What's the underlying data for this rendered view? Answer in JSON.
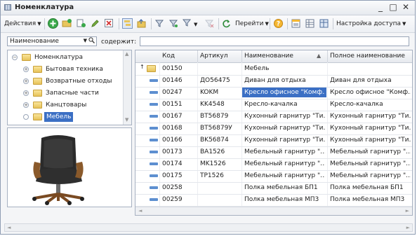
{
  "window": {
    "title": "Номенклатура",
    "controls": [
      "_",
      "□",
      "✕"
    ]
  },
  "toolbar": {
    "actions_label": "Действия",
    "goto_label": "Перейти",
    "access_label": "Настройка доступа"
  },
  "filter": {
    "field_value": "Наименование",
    "contains_label": "содержит:",
    "search_value": ""
  },
  "tree": {
    "items": [
      {
        "label": "Номенклатура",
        "level": 0,
        "expander": "−",
        "selected": false
      },
      {
        "label": "Бытовая техника",
        "level": 1,
        "expander": "+",
        "selected": false
      },
      {
        "label": "Возвратные отходы",
        "level": 1,
        "expander": "+",
        "selected": false
      },
      {
        "label": "Запасные части",
        "level": 1,
        "expander": "+",
        "selected": false
      },
      {
        "label": "Канцтовары",
        "level": 1,
        "expander": "+",
        "selected": false
      },
      {
        "label": "Мебель",
        "level": 1,
        "expander": "",
        "selected": true
      }
    ]
  },
  "grid": {
    "columns": [
      "Код",
      "Артикул",
      "Наименование",
      "Полное наименование"
    ],
    "sorted_column_indicator": "▲",
    "parent_row": {
      "code": "00150",
      "name": "Мебель"
    },
    "rows": [
      {
        "code": "00146",
        "article": "ДО56475",
        "name": "Диван для отдыха",
        "full": "Диван для отдыха",
        "selected": false
      },
      {
        "code": "00247",
        "article": "KOKM",
        "name": "Кресло офисное \"Комф...",
        "full": "Кресло офисное \"Комф...",
        "selected": true
      },
      {
        "code": "00151",
        "article": "KK4548",
        "name": "Кресло-качалка",
        "full": "Кресло-качалка",
        "selected": false
      },
      {
        "code": "00167",
        "article": "BT56879",
        "name": "Кухонный гарнитур \"Ти...",
        "full": "Кухонный гарнитур \"Ти...",
        "selected": false
      },
      {
        "code": "00168",
        "article": "BT56879У",
        "name": "Кухонный гарнитур \"Ти...",
        "full": "Кухонный гарнитур \"Ти...",
        "selected": false
      },
      {
        "code": "00166",
        "article": "BK56874",
        "name": "Кухонный гарнитур \"Ти...",
        "full": "Кухонный гарнитур \"Ти...",
        "selected": false
      },
      {
        "code": "00173",
        "article": "BA1526",
        "name": "Мебельный гарнитур \"...",
        "full": "Мебельный гарнитур \"...",
        "selected": false
      },
      {
        "code": "00174",
        "article": "MK1526",
        "name": "Мебельный гарнитур \"...",
        "full": "Мебельный гарнитур \"...",
        "selected": false
      },
      {
        "code": "00175",
        "article": "TP1526",
        "name": "Мебельный гарнитур \"...",
        "full": "Мебельный гарнитур \"...",
        "selected": false
      },
      {
        "code": "00258",
        "article": "",
        "name": "Полка мебельная БП1",
        "full": "Полка мебельная БП1",
        "selected": false
      },
      {
        "code": "00259",
        "article": "",
        "name": "Полка мебельная МП3",
        "full": "Полка мебельная МП3",
        "selected": false
      }
    ]
  },
  "colors": {
    "selection": "#3b6fc4",
    "row_icon": "#5d8fd0",
    "folder": "#e7c35a"
  }
}
